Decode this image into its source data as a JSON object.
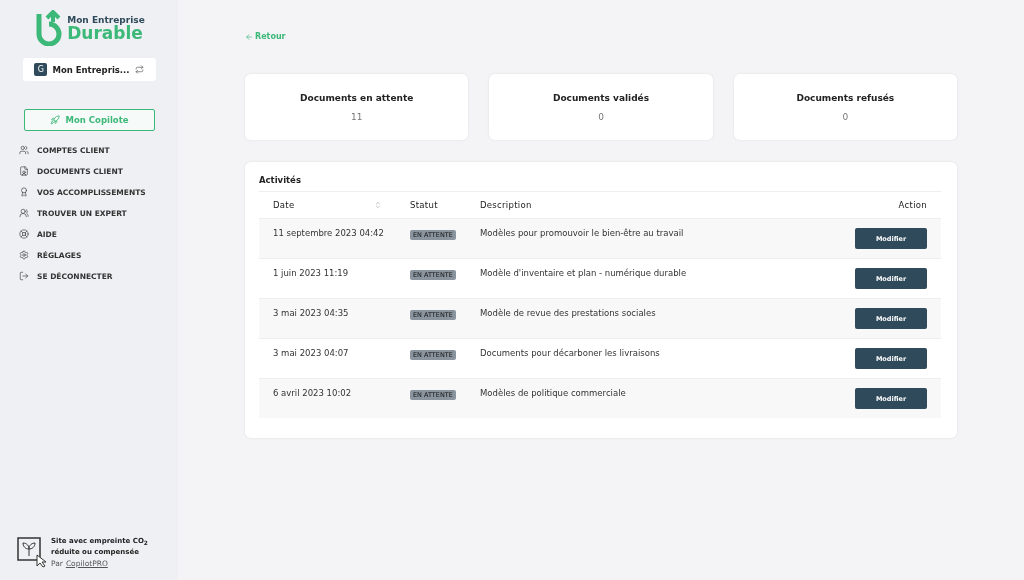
{
  "sidebar": {
    "logo": {
      "top": "Mon Entreprise",
      "bottom": "Durable"
    },
    "account": {
      "initial": "G",
      "name": "Mon Entrepris..."
    },
    "copilot_button": "Mon Copilote",
    "items": [
      {
        "label": "COMPTES CLIENT",
        "kind": "users"
      },
      {
        "label": "DOCUMENTS CLIENT",
        "kind": "document"
      },
      {
        "label": "VOS ACCOMPLISSEMENTS",
        "kind": "award"
      },
      {
        "label": "TROUVER UN EXPERT",
        "kind": "experts"
      },
      {
        "label": "AIDE",
        "kind": "help"
      },
      {
        "label": "RÉGLAGES",
        "kind": "settings"
      },
      {
        "label": "SE DÉCONNECTER",
        "kind": "logout"
      }
    ],
    "footer": {
      "text": "Site avec empreinte CO$_{2}$ réduite ou compensée",
      "by": "Par",
      "link": "CopilotPRO"
    }
  },
  "back_link": "Retour",
  "stats": [
    {
      "title": "Documents en attente",
      "value": "11"
    },
    {
      "title": "Documents validés",
      "value": "0"
    },
    {
      "title": "Documents refusés",
      "value": "0"
    }
  ],
  "activities": {
    "title": "Activités",
    "columns": [
      "Date",
      "Statut",
      "Description",
      "Action"
    ],
    "rows": [
      {
        "date": "11 septembre 2023 04:42",
        "status": "EN ATTENTE",
        "description": "Modèles pour promouvoir le bien-être au travail",
        "action": "Modifier"
      },
      {
        "date": "1 juin 2023 11:19",
        "status": "EN ATTENTE",
        "description": "Modèle d'inventaire et plan - numérique durable",
        "action": "Modifier"
      },
      {
        "date": "3 mai 2023 04:35",
        "status": "EN ATTENTE",
        "description": "Modèle de revue des prestations sociales",
        "action": "Modifier"
      },
      {
        "date": "3 mai 2023 04:07",
        "status": "EN ATTENTE",
        "description": "Documents pour décarboner les livraisons",
        "action": "Modifier"
      },
      {
        "date": "6 avril 2023 10:02",
        "status": "EN ATTENTE",
        "description": "Modèles de politique commerciale",
        "action": "Modifier"
      }
    ]
  }
}
